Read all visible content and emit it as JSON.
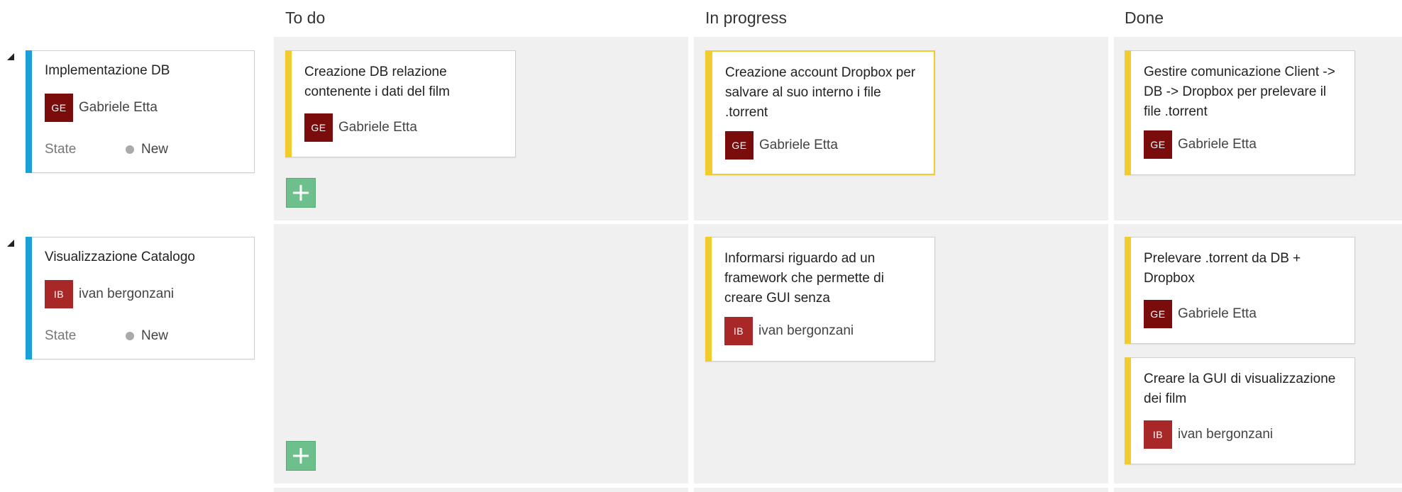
{
  "columns": [
    {
      "label": "To do"
    },
    {
      "label": "In progress"
    },
    {
      "label": "Done"
    }
  ],
  "colors": {
    "parent_bar": "#1ba1d8",
    "task_bar": "#f2cb2f",
    "selected_border": "#f2cb2f",
    "add_button": "#6dbf8b",
    "lane_background": "#f0f0f0",
    "avatar_GE": "#7a0c0c",
    "avatar_IB": "#a82828"
  },
  "icons": {
    "collapse": "triangle-collapse-icon",
    "add": "plus-icon",
    "state": "state-dot-icon"
  },
  "rows": [
    {
      "parent": {
        "title": "Implementazione DB",
        "avatar": "GE",
        "assignee": "Gabriele Etta",
        "state_label": "State",
        "state_value": "New"
      },
      "todo": [
        {
          "title": "Creazione DB relazione contenente i dati del film",
          "avatar": "GE",
          "assignee": "Gabriele Etta"
        }
      ],
      "in_progress": [
        {
          "title": "Creazione account Dropbox per salvare al suo interno i file .torrent",
          "avatar": "GE",
          "assignee": "Gabriele Etta"
        }
      ],
      "done": [
        {
          "title": "Gestire comunicazione Client -> DB -> Dropbox per prelevare il file .torrent",
          "avatar": "GE",
          "assignee": "Gabriele Etta"
        }
      ]
    },
    {
      "parent": {
        "title": "Visualizzazione Catalogo",
        "avatar": "IB",
        "assignee": "ivan bergonzani",
        "state_label": "State",
        "state_value": "New"
      },
      "todo": [],
      "in_progress": [
        {
          "title": "Informarsi riguardo ad un framework che permette di creare GUI senza",
          "avatar": "IB",
          "assignee": "ivan bergonzani"
        }
      ],
      "done": [
        {
          "title": "Prelevare .torrent da DB + Dropbox",
          "avatar": "GE",
          "assignee": "Gabriele Etta"
        },
        {
          "title": "Creare la GUI di visualizzazione dei film",
          "avatar": "IB",
          "assignee": "ivan bergonzani"
        }
      ]
    }
  ]
}
